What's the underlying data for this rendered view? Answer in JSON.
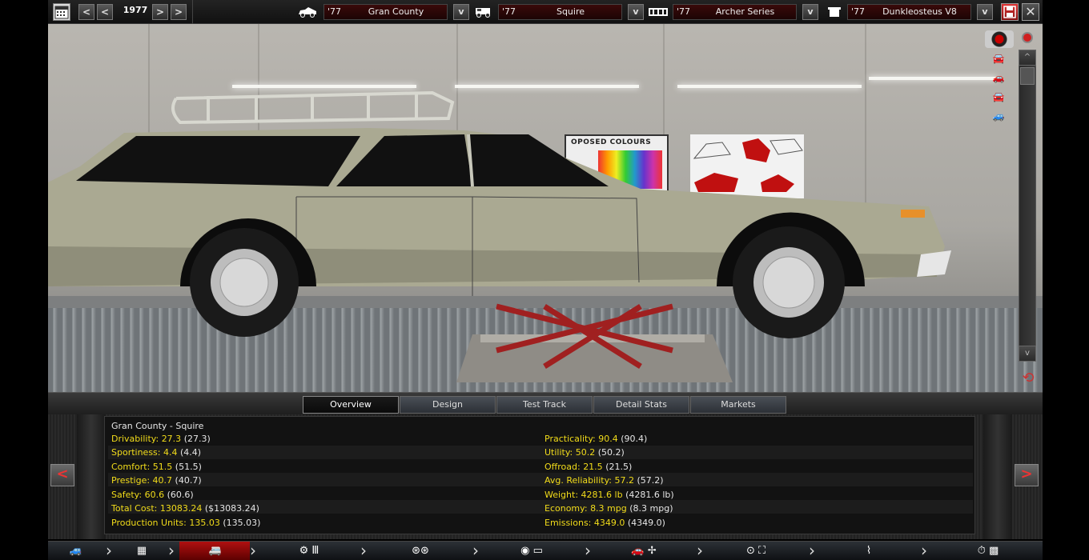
{
  "topbar": {
    "year": "1977",
    "prev_big": "<",
    "prev": "<",
    "next": ">",
    "next_big": ">",
    "selectors": [
      {
        "icon": "car-body-icon",
        "year": "'77",
        "name": "Gran County"
      },
      {
        "icon": "car-trim-icon",
        "year": "'77",
        "name": "Squire"
      },
      {
        "icon": "chassis-icon",
        "year": "'77",
        "name": "Archer Series"
      },
      {
        "icon": "engine-icon",
        "year": "'77",
        "name": "Dunkleosteus V8"
      }
    ],
    "dropdown_label": "v"
  },
  "scene": {
    "poster_title": "OPOSED COLOURS",
    "scroll_up": "^",
    "scroll_down": "v"
  },
  "tabs": [
    {
      "label": "Overview",
      "active": true
    },
    {
      "label": "Design",
      "active": false
    },
    {
      "label": "Test Track",
      "active": false
    },
    {
      "label": "Detail Stats",
      "active": false
    },
    {
      "label": "Markets",
      "active": false
    }
  ],
  "stats": {
    "header": "Gran County - Squire",
    "left": [
      {
        "label": "Drivability:",
        "value": "27.3",
        "prev": "(27.3)"
      },
      {
        "label": "Sportiness:",
        "value": "4.4",
        "prev": "(4.4)"
      },
      {
        "label": "Comfort:",
        "value": "51.5",
        "prev": "(51.5)"
      },
      {
        "label": "Prestige:",
        "value": "40.7",
        "prev": "(40.7)"
      },
      {
        "label": "Safety:",
        "value": "60.6",
        "prev": "(60.6)"
      },
      {
        "label": "Total Cost:",
        "value": "13083.24",
        "prev": "($13083.24)"
      },
      {
        "label": "Production Units:",
        "value": "135.03",
        "prev": "(135.03)"
      }
    ],
    "right": [
      {
        "label": "Practicality:",
        "value": "90.4",
        "prev": "(90.4)"
      },
      {
        "label": "Utility:",
        "value": "50.2",
        "prev": "(50.2)"
      },
      {
        "label": "Offroad:",
        "value": "21.5",
        "prev": "(21.5)"
      },
      {
        "label": "Avg. Reliability:",
        "value": "57.2",
        "prev": "(57.2)"
      },
      {
        "label": "Weight:",
        "value": "4281.6 lb",
        "prev": "(4281.6 lb)"
      },
      {
        "label": "Economy:",
        "value": "8.3 mpg",
        "prev": "(8.3 mpg)"
      },
      {
        "label": "Emissions:",
        "value": "4349.0",
        "prev": "(4349.0)"
      }
    ],
    "nav_prev": "<",
    "nav_next": ">"
  },
  "bottom_nav": [
    {
      "icon": "car-body-icon",
      "glyph": "🚙"
    },
    {
      "icon": "chassis-icon",
      "glyph": "▦"
    },
    {
      "icon": "car-trim-icon",
      "glyph": "🚐",
      "active": true
    },
    {
      "icon": "gearbox-icon",
      "glyph": "⚙ Ⅲ"
    },
    {
      "icon": "wheels-icon",
      "glyph": "⊛⊛"
    },
    {
      "icon": "brakes-icon",
      "glyph": "◉ ▭"
    },
    {
      "icon": "car-design-fan-icon",
      "glyph": "🚗 ✢"
    },
    {
      "icon": "interior-icon",
      "glyph": "⊙ ⛶"
    },
    {
      "icon": "suspension-icon",
      "glyph": "⌇"
    },
    {
      "icon": "testing-finish-icon",
      "glyph": "⏱ ▩"
    }
  ],
  "colors": {
    "accent_yellow": "#f2dc1a",
    "car_body": "#a8a890",
    "lift_red": "#a02020"
  }
}
